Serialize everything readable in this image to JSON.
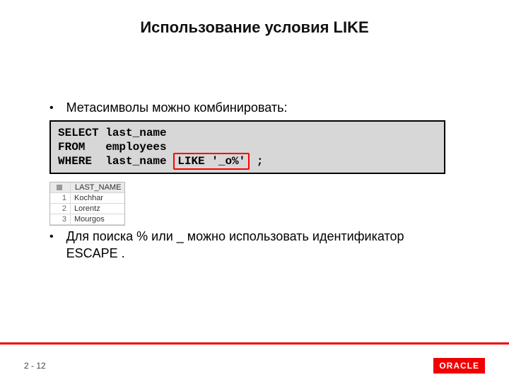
{
  "title": "Использование условия LIKE",
  "bullets": {
    "first": "Метасимволы можно комбинировать:",
    "second": "Для поиска % или _ можно использовать идентификатор ESCAPE ."
  },
  "code": {
    "line1_pre": "SELECT last_name",
    "line2_pre": "FROM   employees",
    "line3_pre": "WHERE  last_name ",
    "line3_box": "LIKE '_o%'",
    "line3_post": " ;"
  },
  "result": {
    "header": "LAST_NAME",
    "rows": [
      {
        "n": "1",
        "v": "Kochhar"
      },
      {
        "n": "2",
        "v": "Lorentz"
      },
      {
        "n": "3",
        "v": "Mourgos"
      }
    ]
  },
  "footer": {
    "page_prefix": "2 - ",
    "page_number": "12",
    "logo_text": "ORACLE"
  }
}
